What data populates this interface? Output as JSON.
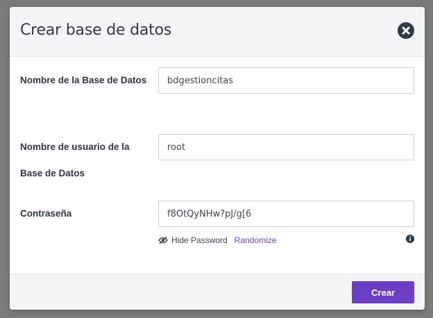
{
  "modal": {
    "title": "Crear base de datos"
  },
  "form": {
    "db_name": {
      "label": "Nombre de la Base de Datos",
      "value": "bdgestioncitas"
    },
    "db_user": {
      "label": "Nombre de usuario de la Base de Datos",
      "value": "root"
    },
    "password": {
      "label": "Contraseña",
      "value": "f8OtQyNHw?pJ/g[6",
      "hide_label": "Hide Password",
      "randomize_label": "Randomize"
    }
  },
  "footer": {
    "submit_label": "Crear"
  },
  "icons": {
    "close": "close-icon",
    "eye": "eye-slash-icon",
    "info": "info-icon"
  },
  "colors": {
    "header_bg": "#f2f6f7",
    "primary": "#6c3fc5",
    "link": "#6b46c1",
    "text": "#2b3640"
  }
}
